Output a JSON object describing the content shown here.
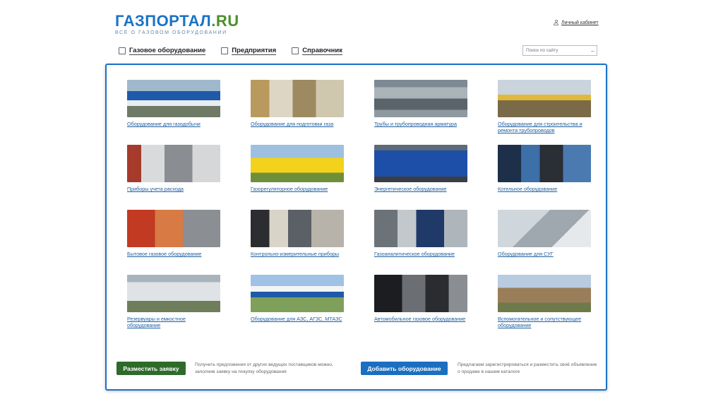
{
  "logo": {
    "main": "ГАЗПОРТАЛ",
    "suffix": ".RU",
    "tagline": "ВСЁ О ГАЗОВОМ ОБОРУДОВАНИИ"
  },
  "header": {
    "cabinet_label": "Личный кабинет"
  },
  "nav": {
    "items": [
      {
        "label": "Газовое оборудование",
        "icon": "flame-icon"
      },
      {
        "label": "Предприятия",
        "icon": "building-icon"
      },
      {
        "label": "Справочник",
        "icon": "book-icon"
      }
    ]
  },
  "search": {
    "placeholder": "Поиск по сайту",
    "button_glyph": "←"
  },
  "categories": [
    {
      "caption": "Оборудование для газодобычи"
    },
    {
      "caption": "Оборудование для подготовки газа"
    },
    {
      "caption": "Трубы и трубопроводная арматура"
    },
    {
      "caption": "Оборудование для строительства и ремонта трубопроводов"
    },
    {
      "caption": "Приборы учета расхода"
    },
    {
      "caption": "Газорегуляторное оборудование"
    },
    {
      "caption": "Энергетическое оборудование"
    },
    {
      "caption": "Котельное оборудование"
    },
    {
      "caption": "Бытовое газовое оборудование"
    },
    {
      "caption": "Контрольно-измерительные приборы"
    },
    {
      "caption": "Газоаналитическое оборудование"
    },
    {
      "caption": "Оборудование для СУГ"
    },
    {
      "caption": "Резервуары и емкостное оборудование"
    },
    {
      "caption": "Оборудование для АЗС, АГЗС, МТАЗС"
    },
    {
      "caption": "Автомобильное газовое оборудование"
    },
    {
      "caption": "Вспомогательное и сопутствующее оборудование"
    }
  ],
  "actions": {
    "place_request_label": "Разместить заявку",
    "place_request_note": "Получить предложения от других ведущих поставщиков можно, заполнив заявку на покупку оборудования",
    "add_equipment_label": "Добавить оборудование",
    "add_equipment_note": "Предлагаем зарегистрироваться и разместить своё объявление о продаже в нашем каталоге"
  }
}
